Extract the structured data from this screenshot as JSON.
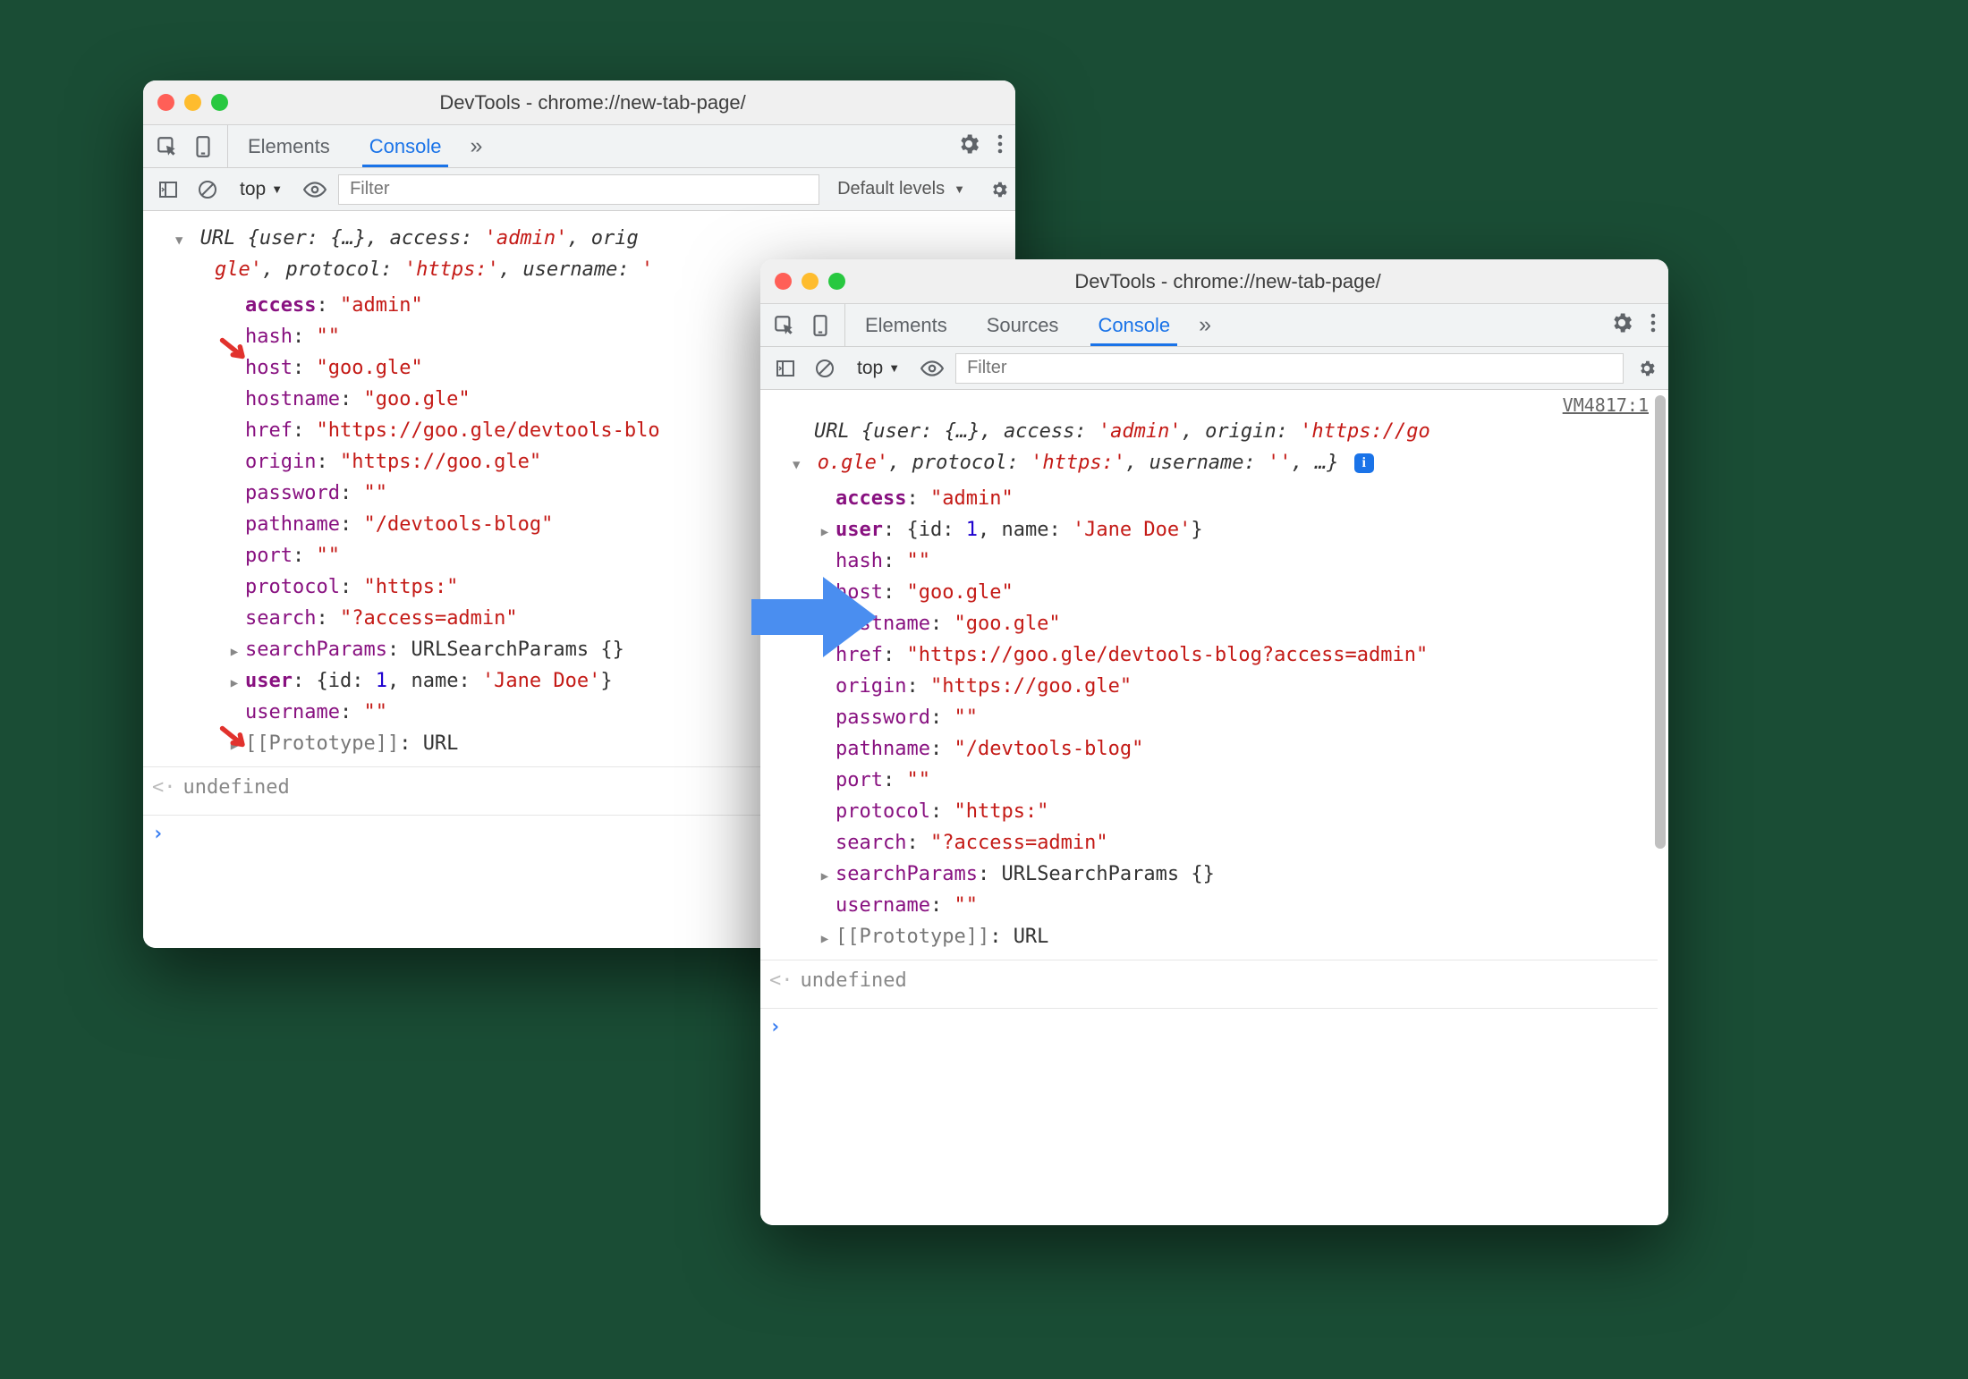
{
  "window_title": "DevTools - chrome://new-tab-page/",
  "tabs": {
    "w1": [
      "Elements",
      "Console"
    ],
    "w2": [
      "Elements",
      "Sources",
      "Console"
    ],
    "active_w1": "Console",
    "active_w2": "Console",
    "more": "»"
  },
  "filterbar": {
    "context": "top",
    "filter_placeholder": "Filter",
    "levels": "Default levels"
  },
  "source_link": "VM4817:1",
  "summary": {
    "class": "URL",
    "line1_a": "{user: {…}, access: ",
    "line1_val": "'admin'",
    "line1_b": ", origin: ",
    "line1_c": "'https://go",
    "line2_a": "o.gle'",
    "line2_b": ", protocol: ",
    "line2_val": "'https:'",
    "line2_c": ", username: ",
    "line2_emp": "''",
    "line2_end": ", …}"
  },
  "w1_summary_partial": {
    "l1": "{user: {…}, access: ",
    "l1v": "'admin'",
    "l1b": ", orig",
    "l2a": "gle'",
    "l2b": ", protocol: ",
    "l2v": "'https:'",
    "l2c": ", username: ",
    "l2d": "'"
  },
  "props_w1": [
    {
      "k": "access",
      "v": "\"admin\"",
      "own": true
    },
    {
      "k": "hash",
      "v": "\"\""
    },
    {
      "k": "host",
      "v": "\"goo.gle\""
    },
    {
      "k": "hostname",
      "v": "\"goo.gle\""
    },
    {
      "k": "href",
      "v": "\"https://goo.gle/devtools-blo",
      "trunc": true
    },
    {
      "k": "origin",
      "v": "\"https://goo.gle\""
    },
    {
      "k": "password",
      "v": "\"\""
    },
    {
      "k": "pathname",
      "v": "\"/devtools-blog\""
    },
    {
      "k": "port",
      "v": "\"\""
    },
    {
      "k": "protocol",
      "v": "\"https:\""
    },
    {
      "k": "search",
      "v": "\"?access=admin\""
    },
    {
      "k": "searchParams",
      "v": "URLSearchParams {}",
      "obj": true,
      "expand": true
    },
    {
      "k": "user",
      "v": "{id: 1, name: 'Jane Doe'}",
      "obj": true,
      "own": true,
      "expand": true
    },
    {
      "k": "username",
      "v": "\"\""
    },
    {
      "k": "[[Prototype]]",
      "v": "URL",
      "proto": true,
      "expand": true
    }
  ],
  "props_w2": [
    {
      "k": "access",
      "v": "\"admin\"",
      "own": true
    },
    {
      "k": "user",
      "v": "{id: 1, name: 'Jane Doe'}",
      "obj": true,
      "own": true,
      "expand": true
    },
    {
      "k": "hash",
      "v": "\"\""
    },
    {
      "k": "host",
      "v": "\"goo.gle\""
    },
    {
      "k": "hostname",
      "v": "\"goo.gle\""
    },
    {
      "k": "href",
      "v": "\"https://goo.gle/devtools-blog?access=admin\""
    },
    {
      "k": "origin",
      "v": "\"https://goo.gle\""
    },
    {
      "k": "password",
      "v": "\"\""
    },
    {
      "k": "pathname",
      "v": "\"/devtools-blog\""
    },
    {
      "k": "port",
      "v": "\"\""
    },
    {
      "k": "protocol",
      "v": "\"https:\""
    },
    {
      "k": "search",
      "v": "\"?access=admin\""
    },
    {
      "k": "searchParams",
      "v": "URLSearchParams {}",
      "obj": true,
      "expand": true
    },
    {
      "k": "username",
      "v": "\"\""
    },
    {
      "k": "[[Prototype]]",
      "v": "URL",
      "proto": true,
      "expand": true
    }
  ],
  "result": "undefined",
  "user_obj": {
    "id": 1,
    "name": "Jane Doe"
  }
}
